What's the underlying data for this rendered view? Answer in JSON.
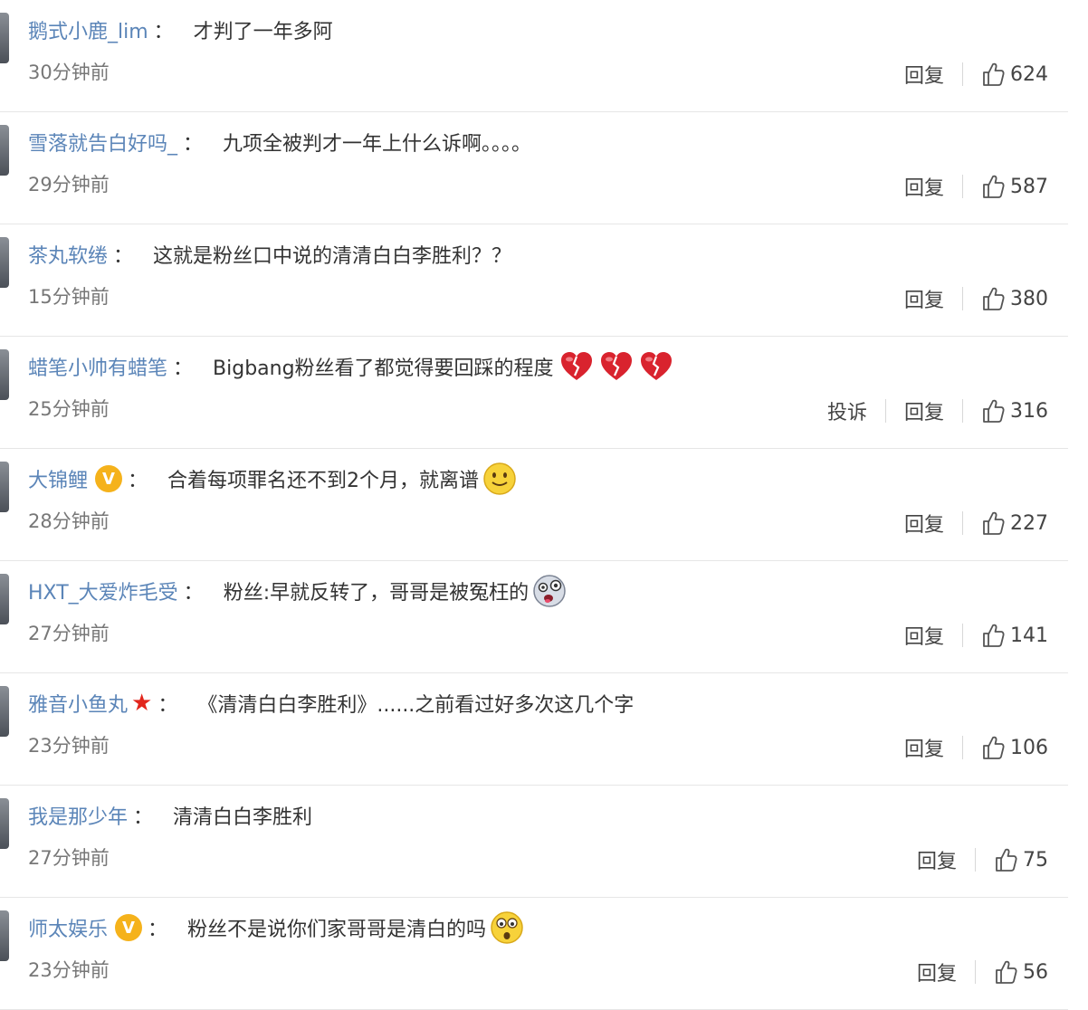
{
  "comments": [
    {
      "user": "鹅式小鹿_lim",
      "badge": "",
      "colon": "：",
      "text": "才判了一年多阿",
      "emoji": "",
      "time": "30分钟前",
      "report": "",
      "reply": "回复",
      "likes": "624"
    },
    {
      "user": "雪落就告白好吗_",
      "badge": "",
      "colon": "：",
      "text": "九项全被判才一年上什么诉啊。。。。",
      "emoji": "",
      "time": "29分钟前",
      "report": "",
      "reply": "回复",
      "likes": "587"
    },
    {
      "user": "茶丸软绻",
      "badge": "",
      "colon": "：",
      "text": "这就是粉丝口中说的清清白白李胜利？？",
      "emoji": "",
      "time": "15分钟前",
      "report": "",
      "reply": "回复",
      "likes": "380"
    },
    {
      "user": "蜡笔小帅有蜡笔",
      "badge": "",
      "colon": "：",
      "text": "Bigbang粉丝看了都觉得要回踩的程度",
      "emoji": "broken-heart-x3",
      "time": "25分钟前",
      "report": "投诉",
      "reply": "回复",
      "likes": "316"
    },
    {
      "user": "大锦鲤",
      "badge": "v",
      "colon": "：",
      "text": "合着每项罪名还不到2个月，就离谱",
      "emoji": "smile-face",
      "time": "28分钟前",
      "report": "",
      "reply": "回复",
      "likes": "227"
    },
    {
      "user": "HXT_大爱炸毛受",
      "badge": "",
      "colon": "：",
      "text": "粉丝:早就反转了，哥哥是被冤枉的",
      "emoji": "crazy-face",
      "time": "27分钟前",
      "report": "",
      "reply": "回复",
      "likes": "141"
    },
    {
      "user": "雅音小鱼丸",
      "badge": "star",
      "colon": "：",
      "text": "《清清白白李胜利》......之前看过好多次这几个字",
      "emoji": "",
      "time": "23分钟前",
      "report": "",
      "reply": "回复",
      "likes": "106"
    },
    {
      "user": "我是那少年",
      "badge": "",
      "colon": "：",
      "text": "清清白白李胜利",
      "emoji": "",
      "time": "27分钟前",
      "report": "",
      "reply": "回复",
      "likes": "75"
    },
    {
      "user": "师太娱乐",
      "badge": "v",
      "colon": "：",
      "text": "粉丝不是说你们家哥哥是清白的吗",
      "emoji": "surprised-face",
      "time": "23分钟前",
      "report": "",
      "reply": "回复",
      "likes": "56"
    }
  ],
  "colors": {
    "username": "#5b85b8",
    "badge_v": "#f5b21b",
    "badge_star": "#e2261c",
    "heart": "#d9232e"
  }
}
